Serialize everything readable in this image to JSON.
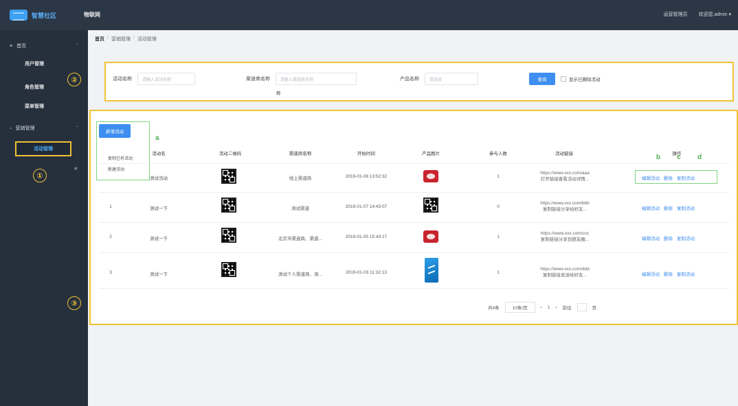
{
  "header": {
    "brand": "智慧社区",
    "module": "物联网",
    "user_1": "运营管理员",
    "user_2": "欢迎您,admin ▾"
  },
  "sidebar": {
    "group_1": "首页",
    "items_1": [
      "用户管理",
      "角色管理",
      "菜单管理"
    ],
    "group_2": "营销管理",
    "active_item": "活动管理"
  },
  "breadcrumb": {
    "home": "首页",
    "crumb_1": "营销管理",
    "crumb_2": "活动管理"
  },
  "callouts": {
    "one": "①",
    "two": "②",
    "three": "③"
  },
  "search": {
    "f1_label": "活动名称",
    "f1_placeholder": "请输入活动名称",
    "f2_label": "渠道商名称",
    "f2_placeholder": "请输入渠道商名称",
    "f2_suffix": "称",
    "f3_label": "产品名称",
    "f3_placeholder": "请选择",
    "button": "查询",
    "checkbox_label": "显示已删除活动"
  },
  "table": {
    "new_button": "新增活动",
    "dropdown_items": [
      "复制已有活动",
      "新建活动"
    ],
    "annotations": {
      "a": "a",
      "b": "b",
      "c": "c",
      "d": "d"
    },
    "headers": [
      "活动名",
      "活动二维码",
      "渠道商名称",
      "开始时间",
      "产品图片",
      "参与人数",
      "活动链接",
      "操作"
    ],
    "rows": [
      {
        "idx": "",
        "name": "测试活动",
        "channel": "线上渠道商",
        "time": "2019-01-08 13:52:32",
        "img": "red",
        "count": "1",
        "link": [
          "https://www.xxx.com/aaa",
          "打开链接查看活动详情..."
        ]
      },
      {
        "idx": "1",
        "name": "测试一下",
        "channel": "测试渠道",
        "time": "2019-01-07 14:43:07",
        "img": "qr",
        "count": "0",
        "link": [
          "https://www.xxx.com/bbb",
          "复制链接分享给好友..."
        ]
      },
      {
        "idx": "2",
        "name": "测试一下",
        "channel": "北京市渠道商、渠道...",
        "time": "2019-01-05 15:43:17",
        "img": "red",
        "count": "1",
        "link": [
          "https://www.xxx.com/ccc",
          "复制链接分享到朋友圈..."
        ]
      },
      {
        "idx": "3",
        "name": "测试一下",
        "channel": "测试个人渠道商、测...",
        "time": "2019-01-03 11:32:13",
        "img": "blue",
        "count": "1",
        "link": [
          "https://www.xxx.com/ddd",
          "复制链接发送给好友..."
        ]
      }
    ],
    "actions": [
      "编辑活动",
      "删除",
      "复制活动"
    ]
  },
  "pager": {
    "total": "共4条",
    "size": "10条/页",
    "prev": "‹",
    "page": "1",
    "next": "›",
    "goto": "前往",
    "goto_suffix": "页"
  }
}
